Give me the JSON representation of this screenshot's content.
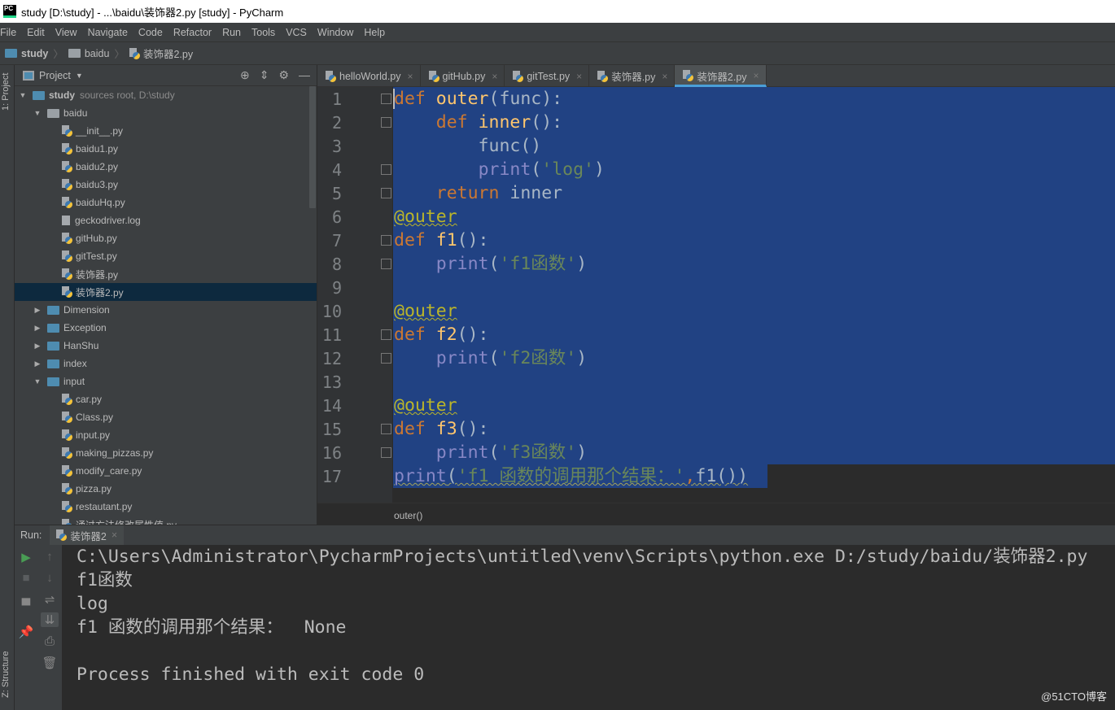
{
  "window": {
    "title": "study [D:\\study] - ...\\baidu\\装饰器2.py [study] - PyCharm"
  },
  "menu": [
    "File",
    "Edit",
    "View",
    "Navigate",
    "Code",
    "Refactor",
    "Run",
    "Tools",
    "VCS",
    "Window",
    "Help"
  ],
  "breadcrumb": [
    "study",
    "baidu",
    "装饰器2.py"
  ],
  "left_strip": {
    "project": "1: Project",
    "structure": "Z: Structure"
  },
  "project": {
    "title": "Project",
    "root": {
      "name": "study",
      "hint": "sources root, D:\\study"
    },
    "tree": [
      {
        "label": "baidu",
        "type": "folder",
        "level": 1,
        "open": true
      },
      {
        "label": "__init__.py",
        "type": "py",
        "level": 2
      },
      {
        "label": "baidu1.py",
        "type": "py",
        "level": 2
      },
      {
        "label": "baidu2.py",
        "type": "py",
        "level": 2
      },
      {
        "label": "baidu3.py",
        "type": "py",
        "level": 2
      },
      {
        "label": "baiduHq.py",
        "type": "py",
        "level": 2
      },
      {
        "label": "geckodriver.log",
        "type": "log",
        "level": 2
      },
      {
        "label": "gitHub.py",
        "type": "py",
        "level": 2
      },
      {
        "label": "gitTest.py",
        "type": "py",
        "level": 2
      },
      {
        "label": "装饰器.py",
        "type": "py",
        "level": 2
      },
      {
        "label": "装饰器2.py",
        "type": "py",
        "level": 2,
        "selected": true
      },
      {
        "label": "Dimension",
        "type": "folder",
        "level": 1,
        "open": false
      },
      {
        "label": "Exception",
        "type": "folder",
        "level": 1,
        "open": false
      },
      {
        "label": "HanShu",
        "type": "folder",
        "level": 1,
        "open": false
      },
      {
        "label": "index",
        "type": "folder",
        "level": 1,
        "open": false
      },
      {
        "label": "input",
        "type": "folder",
        "level": 1,
        "open": true
      },
      {
        "label": "car.py",
        "type": "py",
        "level": 2
      },
      {
        "label": "Class.py",
        "type": "py",
        "level": 2
      },
      {
        "label": "input.py",
        "type": "py",
        "level": 2
      },
      {
        "label": "making_pizzas.py",
        "type": "py",
        "level": 2
      },
      {
        "label": "modify_care.py",
        "type": "py",
        "level": 2
      },
      {
        "label": "pizza.py",
        "type": "py",
        "level": 2
      },
      {
        "label": "restautant.py",
        "type": "py",
        "level": 2
      },
      {
        "label": "通过方法修改属性值.py",
        "type": "py",
        "level": 2
      }
    ]
  },
  "tabs": [
    {
      "label": "helloWorld.py"
    },
    {
      "label": "gitHub.py"
    },
    {
      "label": "gitTest.py"
    },
    {
      "label": "装饰器.py"
    },
    {
      "label": "装饰器2.py",
      "active": true
    }
  ],
  "code": [
    [
      [
        "def ",
        "kw"
      ],
      [
        "outer",
        "fn"
      ],
      [
        "(func):",
        "pl"
      ]
    ],
    [
      [
        "    def ",
        "kw"
      ],
      [
        "inner",
        "fn"
      ],
      [
        "():",
        "pl"
      ]
    ],
    [
      [
        "        func()",
        "pl"
      ]
    ],
    [
      [
        "        ",
        "pl"
      ],
      [
        "print",
        "bi"
      ],
      [
        "(",
        "pl"
      ],
      [
        "'log'",
        "st"
      ],
      [
        ")",
        "pl"
      ]
    ],
    [
      [
        "    return ",
        "kw"
      ],
      [
        "inner",
        "pl"
      ]
    ],
    [
      [
        "@outer",
        "dec"
      ]
    ],
    [
      [
        "def ",
        "kw"
      ],
      [
        "f1",
        "fn"
      ],
      [
        "():",
        "pl"
      ]
    ],
    [
      [
        "    ",
        "pl"
      ],
      [
        "print",
        "bi"
      ],
      [
        "(",
        "pl"
      ],
      [
        "'f1函数'",
        "st"
      ],
      [
        ")",
        "pl"
      ]
    ],
    [],
    [
      [
        "@outer",
        "dec"
      ]
    ],
    [
      [
        "def ",
        "kw"
      ],
      [
        "f2",
        "fn"
      ],
      [
        "():",
        "pl"
      ]
    ],
    [
      [
        "    ",
        "pl"
      ],
      [
        "print",
        "bi"
      ],
      [
        "(",
        "pl"
      ],
      [
        "'f2函数'",
        "st"
      ],
      [
        ")",
        "pl"
      ]
    ],
    [],
    [
      [
        "@outer",
        "dec"
      ]
    ],
    [
      [
        "def ",
        "kw"
      ],
      [
        "f3",
        "fn"
      ],
      [
        "():",
        "pl"
      ]
    ],
    [
      [
        "    ",
        "pl"
      ],
      [
        "print",
        "bi"
      ],
      [
        "(",
        "pl"
      ],
      [
        "'f3函数'",
        "st"
      ],
      [
        ")",
        "pl"
      ]
    ],
    [
      [
        "print",
        "bi wavy"
      ],
      [
        "(",
        "pl wavy"
      ],
      [
        "'f1 函数的调用那个结果：'",
        "st wavy"
      ],
      [
        ",",
        "kw wavy"
      ],
      [
        "f1())",
        "pl wavy"
      ]
    ]
  ],
  "editor_status": "outer()",
  "run": {
    "label": "Run:",
    "tab": "装饰器2",
    "output": [
      "C:\\Users\\Administrator\\PycharmProjects\\untitled\\venv\\Scripts\\python.exe D:/study/baidu/装饰器2.py",
      "f1函数",
      "log",
      "f1 函数的调用那个结果：  None",
      "",
      "Process finished with exit code 0"
    ]
  },
  "watermark": "@51CTO博客",
  "colors": {
    "selection": "#214283",
    "keyword": "#cc7832",
    "function": "#ffc66d",
    "builtin": "#8888c6",
    "string": "#6a8759",
    "decorator": "#bbb529",
    "run_green": "#499c54"
  }
}
